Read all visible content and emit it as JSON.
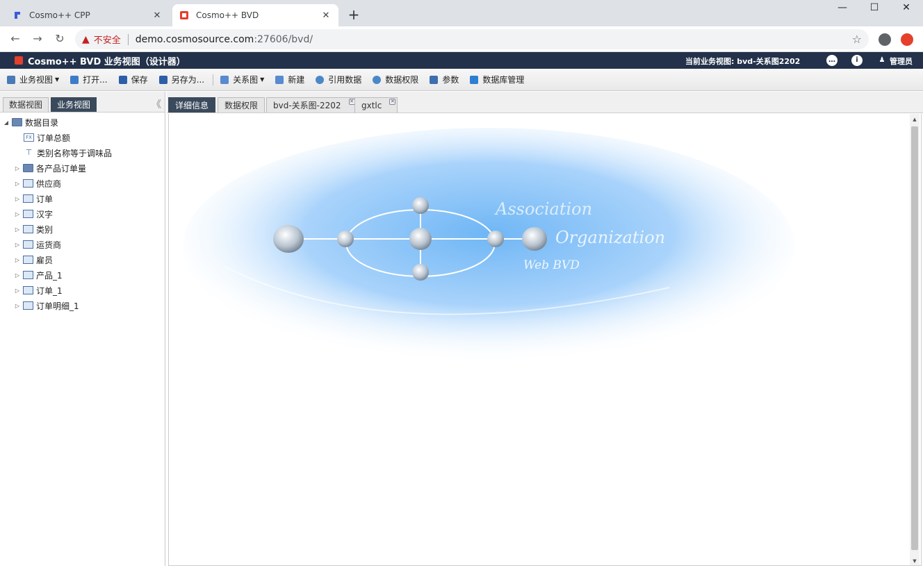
{
  "browser": {
    "tabs": [
      {
        "title": "Cosmo++ CPP",
        "icon": "cpp-favicon",
        "close": "✕"
      },
      {
        "title": "Cosmo++ BVD",
        "icon": "bvd-favicon",
        "close": "✕"
      }
    ],
    "new_tab": "+",
    "window_controls": {
      "minimize": "—",
      "maximize": "☐",
      "close": "✕"
    },
    "address": {
      "security_label": "不安全",
      "host": "demo.cosmosource.com",
      "path": ":27606/bvd/"
    }
  },
  "app": {
    "title": "Cosmo++ BVD 业务视图（设计器）",
    "current_view": "当前业务视图: bvd-关系图2202",
    "user": "管理员",
    "colors": {
      "header": "#23324a",
      "active_tab": "#3a4a5c",
      "logo": "#e4402c"
    }
  },
  "toolbar": {
    "items": [
      {
        "label": "业务视图",
        "icon": "view-icon",
        "dropdown": true
      },
      {
        "label": "打开...",
        "icon": "folder-open-icon"
      },
      {
        "label": "保存",
        "icon": "save-icon"
      },
      {
        "label": "另存为...",
        "icon": "save-as-icon"
      },
      {
        "label": "关系图",
        "icon": "relation-icon",
        "dropdown": true
      },
      {
        "label": "新建",
        "icon": "new-icon"
      },
      {
        "label": "引用数据",
        "icon": "database-icon"
      },
      {
        "label": "数据权限",
        "icon": "permission-icon"
      },
      {
        "label": "参数",
        "icon": "param-icon"
      },
      {
        "label": "数据库管理",
        "icon": "db-manage-icon"
      }
    ]
  },
  "left": {
    "tabs": [
      "数据视图",
      "业务视图"
    ],
    "active_tab": "业务视图",
    "collapse": "《",
    "tree": {
      "root": "数据目录",
      "items": [
        {
          "label": "订单总额",
          "type": "fx"
        },
        {
          "label": "类别名称等于调味品",
          "type": "filter"
        },
        {
          "label": "各产品订单量",
          "type": "folder"
        },
        {
          "label": "供应商",
          "type": "table"
        },
        {
          "label": "订单",
          "type": "table"
        },
        {
          "label": "汉字",
          "type": "table"
        },
        {
          "label": "类别",
          "type": "table"
        },
        {
          "label": "运货商",
          "type": "table"
        },
        {
          "label": "雇员",
          "type": "table"
        },
        {
          "label": "产品_1",
          "type": "table"
        },
        {
          "label": "订单_1",
          "type": "table"
        },
        {
          "label": "订单明细_1",
          "type": "table"
        }
      ]
    }
  },
  "main": {
    "tabs": [
      {
        "label": "详细信息",
        "active": true,
        "closable": false
      },
      {
        "label": "数据权限",
        "active": false,
        "closable": false
      },
      {
        "label": "bvd-关系图-2202",
        "active": false,
        "closable": true
      },
      {
        "label": "gxtlc",
        "active": false,
        "closable": true
      }
    ],
    "banner": {
      "line1": "Association",
      "line2": "Organization",
      "line3": "Web BVD"
    }
  }
}
